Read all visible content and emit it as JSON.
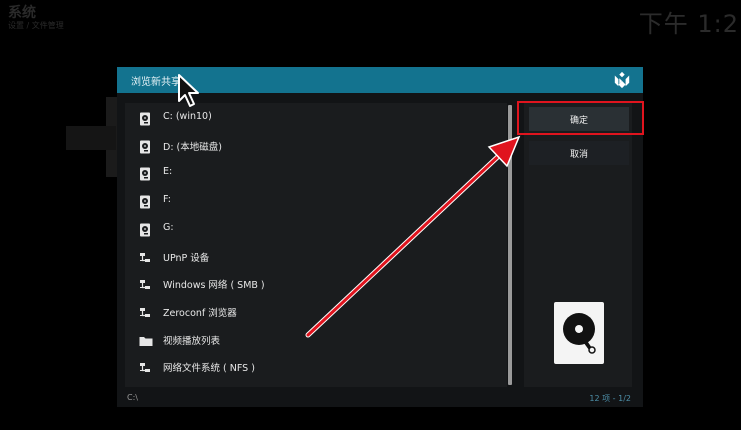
{
  "background": {
    "top_left_title": "系统",
    "top_left_subtitle": "设置 / 文件管理",
    "clock": "下午 1:2"
  },
  "dialog": {
    "title": "浏览新共享",
    "items": [
      {
        "label": "C: (win10)",
        "icon": "drive-icon"
      },
      {
        "label": "D: (本地磁盘)",
        "icon": "drive-icon"
      },
      {
        "label": "E:",
        "icon": "drive-icon"
      },
      {
        "label": "F:",
        "icon": "drive-icon"
      },
      {
        "label": "G:",
        "icon": "drive-icon"
      },
      {
        "label": "UPnP 设备",
        "icon": "network-icon"
      },
      {
        "label": "Windows 网络 ( SMB )",
        "icon": "network-icon"
      },
      {
        "label": "Zeroconf 浏览器",
        "icon": "network-icon"
      },
      {
        "label": "视频播放列表",
        "icon": "folder-icon"
      },
      {
        "label": "网络文件系统 ( NFS )",
        "icon": "network-icon"
      }
    ],
    "ok_label": "确定",
    "cancel_label": "取消",
    "current_path": "C:\\",
    "item_count": "12",
    "page_indicator": "12 项 - 1/2"
  },
  "colors": {
    "header": "#13738f",
    "highlight": "#e0141e",
    "arrow": "#e0141e"
  }
}
